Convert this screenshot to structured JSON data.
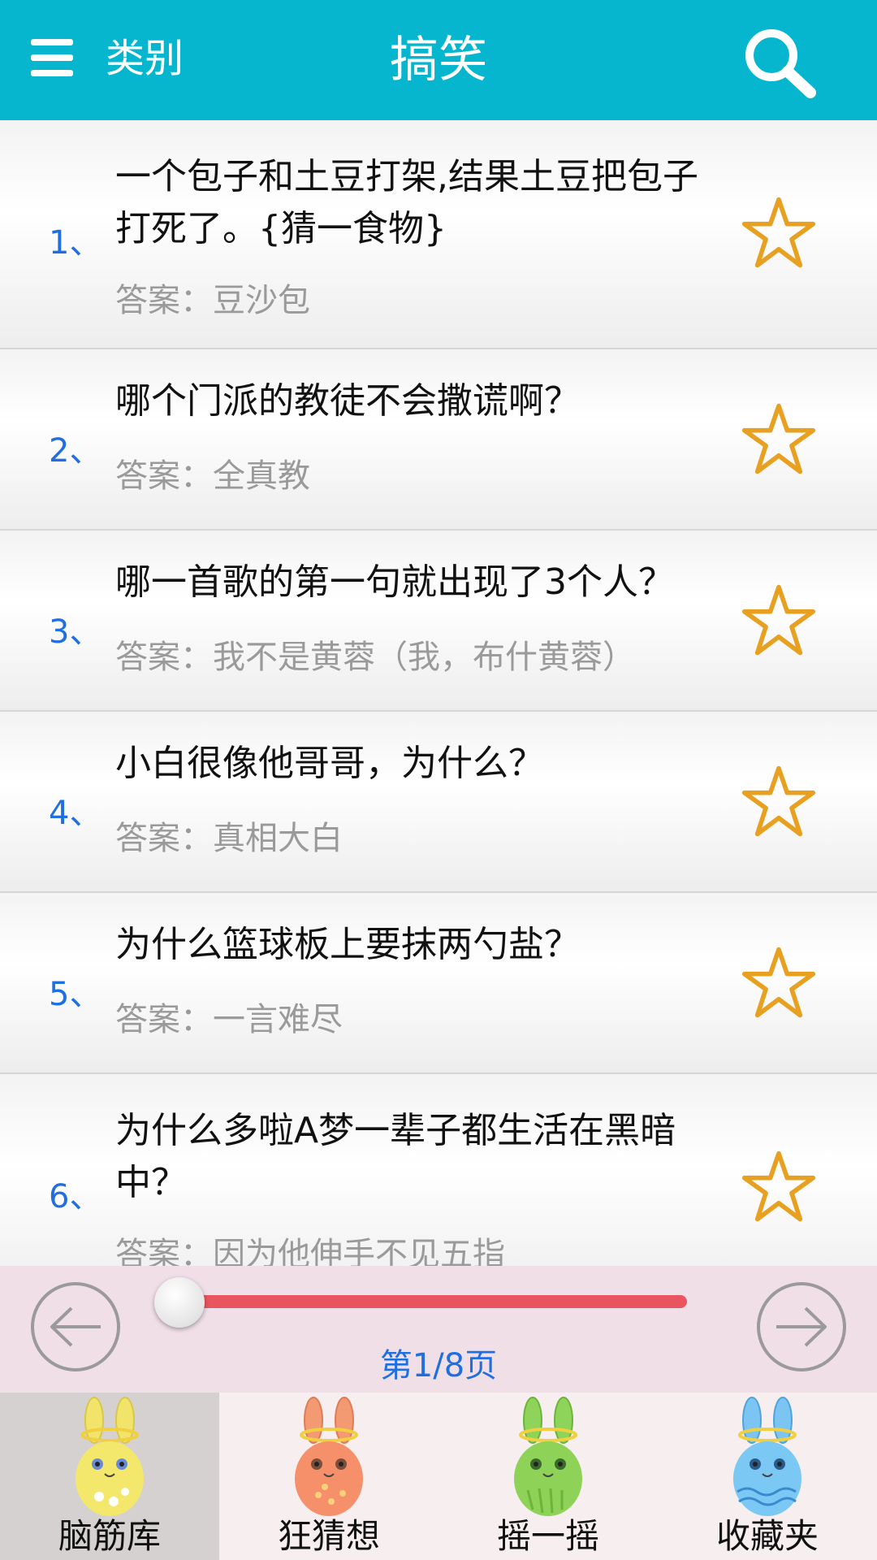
{
  "header": {
    "menu_icon": "menu-icon",
    "category_label": "类别",
    "title": "搞笑",
    "search_icon": "search-icon"
  },
  "colors": {
    "header_bg": "#06b6cf",
    "number_blue": "#1f6fe0",
    "slider_red": "#e8545f",
    "star_orange": "#e8a020",
    "pager_bg": "#f1dfe8"
  },
  "riddles": [
    {
      "num": "1、",
      "question": "一个包子和土豆打架,结果土豆把包子打死了。{猜一食物}",
      "answer": "答案：豆沙包",
      "starred": false
    },
    {
      "num": "2、",
      "question": "哪个门派的教徒不会撒谎啊？",
      "answer": "答案：全真教",
      "starred": false
    },
    {
      "num": "3、",
      "question": "哪一首歌的第一句就出现了3个人？",
      "answer": "答案：我不是黄蓉（我，布什黄蓉）",
      "starred": false
    },
    {
      "num": "4、",
      "question": "小白很像他哥哥，为什么？",
      "answer": "答案：真相大白",
      "starred": false
    },
    {
      "num": "5、",
      "question": "为什么篮球板上要抹两勺盐？",
      "answer": "答案：一言难尽",
      "starred": false
    },
    {
      "num": "6、",
      "question": "为什么多啦A梦一辈子都生活在黑暗中？",
      "answer": "答案：因为他伸手不见五指",
      "starred": false
    }
  ],
  "pager": {
    "prev_icon": "arrow-left-icon",
    "next_icon": "arrow-right-icon",
    "page_text": "第1/8页",
    "progress": 0.0
  },
  "tabs": [
    {
      "label": "脑筋库",
      "icon": "yellow-bunny-icon",
      "active": true
    },
    {
      "label": "狂猜想",
      "icon": "orange-bunny-icon",
      "active": false
    },
    {
      "label": "摇一摇",
      "icon": "green-bunny-icon",
      "active": false
    },
    {
      "label": "收藏夹",
      "icon": "blue-bunny-icon",
      "active": false
    }
  ]
}
